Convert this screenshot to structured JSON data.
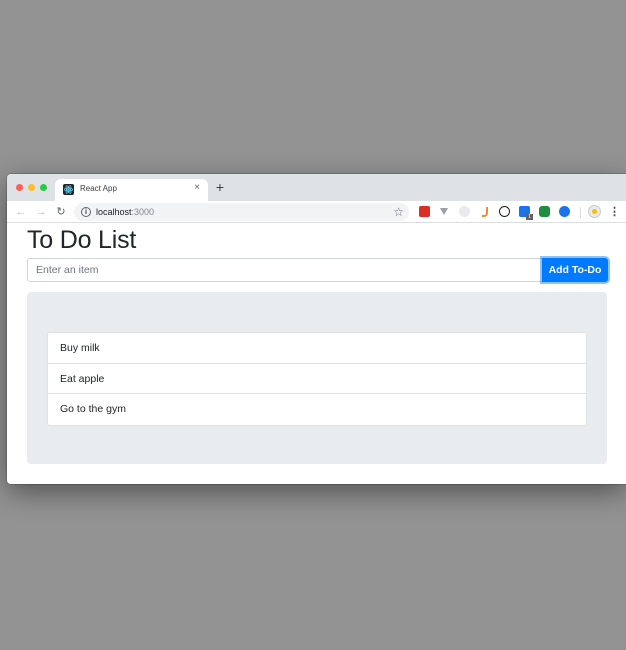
{
  "browser": {
    "tab": {
      "title": "React App",
      "close_glyph": "×"
    },
    "new_tab_glyph": "+",
    "nav": {
      "back_glyph": "←",
      "forward_glyph": "→",
      "reload_glyph": "↻"
    },
    "address": {
      "host": "localhost",
      "port": ":3000",
      "info_glyph": "i",
      "star_glyph": "☆"
    },
    "extensions": [
      "red-extension-icon",
      "vue-devtools-icon",
      "ghost-extension-icon",
      "hook-extension-icon",
      "info-circle-extension-icon",
      "blue-extension-icon",
      "green-extension-icon",
      "zoom-extension-icon"
    ],
    "extension_badge": "1",
    "menu_glyph": "⋮",
    "traffic_colors": {
      "close": "#fe5f57",
      "minimize": "#febc2e",
      "maximize": "#28c840"
    }
  },
  "app": {
    "title": "To Do List",
    "input": {
      "placeholder": "Enter an item",
      "value": ""
    },
    "add_button_label": "Add To-Do",
    "accent_color": "#007bff",
    "panel_color": "#e9ecef",
    "items": [
      {
        "label": "Buy milk"
      },
      {
        "label": "Eat apple"
      },
      {
        "label": "Go to the gym"
      }
    ]
  }
}
